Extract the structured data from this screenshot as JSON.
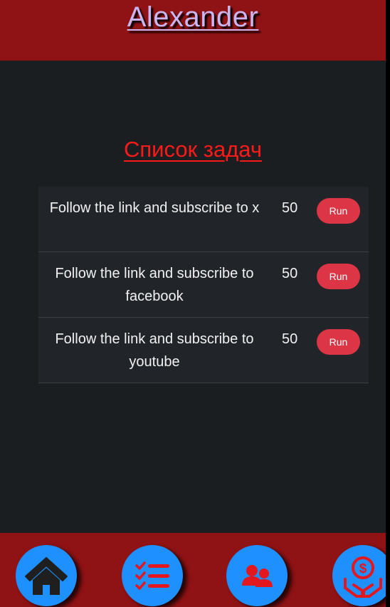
{
  "header": {
    "username": "Alexander"
  },
  "tasks": {
    "title": "Список задач",
    "items": [
      {
        "text": "Follow the link and subscribe to x",
        "reward": "50",
        "button_label": "Run"
      },
      {
        "text": "Follow the link and subscribe to facebook",
        "reward": "50",
        "button_label": "Run"
      },
      {
        "text": "Follow the link and subscribe to youtube",
        "reward": "50",
        "button_label": "Run"
      }
    ]
  },
  "nav": {
    "items": [
      {
        "icon": "home-icon"
      },
      {
        "icon": "task-list-icon"
      },
      {
        "icon": "users-icon"
      },
      {
        "icon": "money-hand-icon"
      }
    ]
  },
  "colors": {
    "header_bg": "#8f1214",
    "page_bg": "#1b1e21",
    "row_bg": "#212529",
    "accent_red": "#ff1a1a",
    "button_red": "#dc3545",
    "nav_button_blue": "#1e90ff",
    "icon_red": "#e3171e"
  }
}
